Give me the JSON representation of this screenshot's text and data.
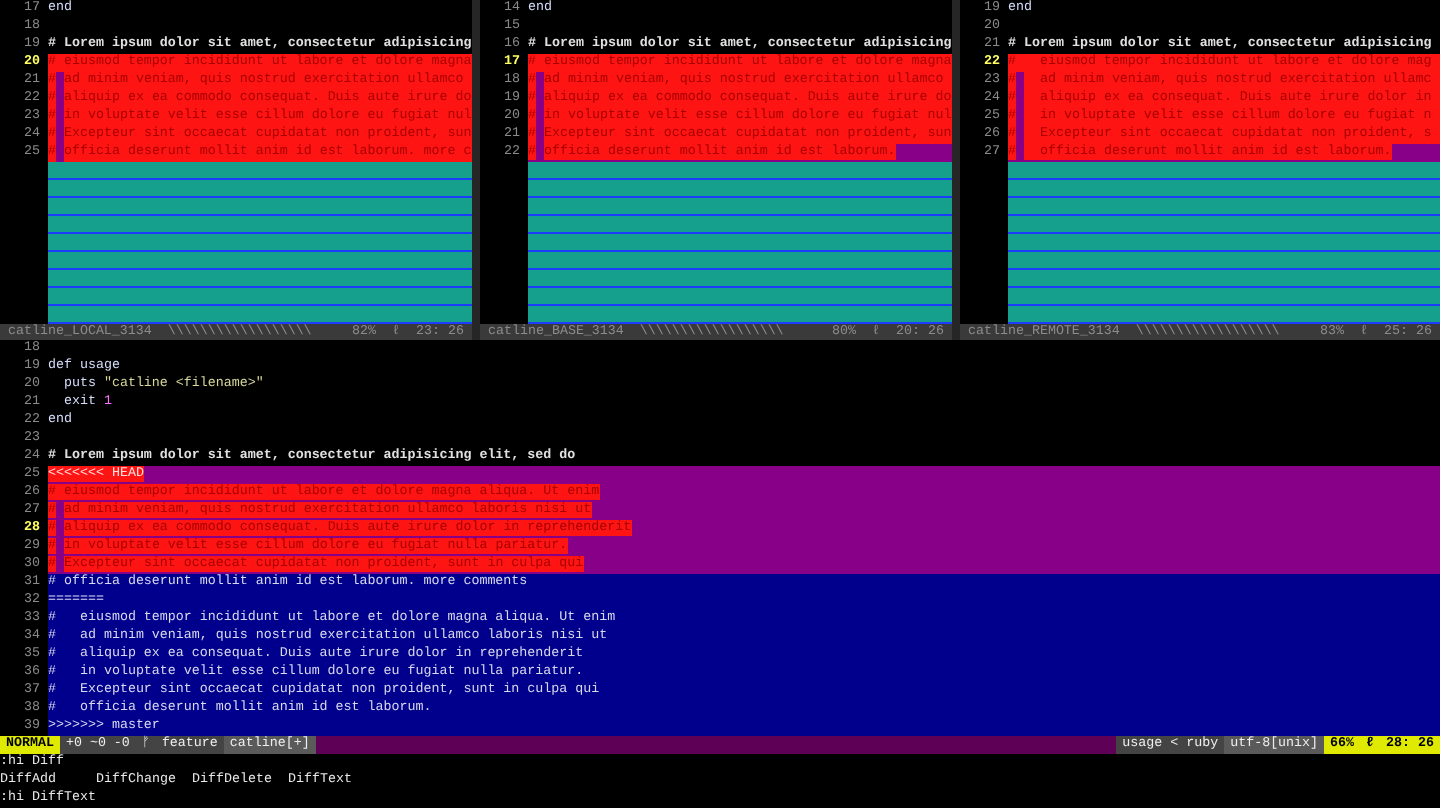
{
  "panes": [
    {
      "lines": [
        {
          "kind": "plain",
          "number": "17",
          "current": false,
          "segments": [
            {
              "text": "end",
              "kind": "keyword"
            }
          ]
        },
        {
          "kind": "plain",
          "number": "18",
          "current": false
        },
        {
          "kind": "plain",
          "number": "19",
          "current": false,
          "segments": [
            {
              "text": "# Lorem ipsum dolor sit amet, consectetur adipisicing",
              "kind": "comment"
            }
          ]
        },
        {
          "kind": "differing",
          "number": "20",
          "current": true,
          "segments": [
            {
              "text": "# eiusmod tempor incididunt ut labore et dolore magna",
              "kind": "differing"
            }
          ]
        },
        {
          "kind": "differing",
          "number": "21",
          "current": false,
          "segments": [
            {
              "text": "#",
              "kind": "differing"
            },
            {
              "kind": "changed_cell"
            },
            {
              "text": "ad minim veniam, quis nostrud exercitation ullamco",
              "kind": "differing"
            }
          ]
        },
        {
          "kind": "differing",
          "number": "22",
          "current": false,
          "segments": [
            {
              "text": "#",
              "kind": "differing"
            },
            {
              "kind": "changed_cell"
            },
            {
              "text": "aliquip ex ea commodo consequat. Duis aute irure do",
              "kind": "differing"
            }
          ]
        },
        {
          "kind": "differing",
          "number": "23",
          "current": false,
          "segments": [
            {
              "text": "#",
              "kind": "differing"
            },
            {
              "kind": "changed_cell"
            },
            {
              "text": "in voluptate velit esse cillum dolore eu fugiat nul",
              "kind": "differing"
            }
          ]
        },
        {
          "kind": "differing",
          "number": "24",
          "current": false,
          "segments": [
            {
              "text": "#",
              "kind": "differing"
            },
            {
              "kind": "changed_cell"
            },
            {
              "text": "Excepteur sint occaecat cupidatat non proident, sun",
              "kind": "differing"
            }
          ]
        },
        {
          "kind": "differing",
          "number": "25",
          "current": false,
          "segments": [
            {
              "text": "#",
              "kind": "differing"
            },
            {
              "kind": "changed_cell"
            },
            {
              "text": "officia deserunt mollit anim id est laborum. more c",
              "kind": "differing"
            }
          ]
        },
        {
          "kind": "filler"
        },
        {
          "kind": "filler"
        },
        {
          "kind": "filler"
        },
        {
          "kind": "filler"
        },
        {
          "kind": "filler"
        },
        {
          "kind": "filler"
        },
        {
          "kind": "filler"
        },
        {
          "kind": "filler"
        },
        {
          "kind": "filler"
        }
      ],
      "status": {
        "file": "catline_LOCAL_3134",
        "fill": "\\\\\\\\\\\\\\\\\\\\\\\\\\\\\\\\\\\\",
        "percent": "82%",
        "linenr_symbol": "ℓ",
        "position": "23: 26"
      }
    },
    {
      "lines": [
        {
          "kind": "plain",
          "number": "14",
          "current": false,
          "segments": [
            {
              "text": "end",
              "kind": "keyword"
            }
          ]
        },
        {
          "kind": "plain",
          "number": "15",
          "current": false
        },
        {
          "kind": "plain",
          "number": "16",
          "current": false,
          "segments": [
            {
              "text": "# Lorem ipsum dolor sit amet, consectetur adipisicing",
              "kind": "comment"
            }
          ]
        },
        {
          "kind": "differing",
          "number": "17",
          "current": true,
          "segments": [
            {
              "text": "# eiusmod tempor incididunt ut labore et dolore magna",
              "kind": "differing"
            }
          ]
        },
        {
          "kind": "differing",
          "number": "18",
          "current": false,
          "segments": [
            {
              "text": "#",
              "kind": "differing"
            },
            {
              "kind": "changed_cell"
            },
            {
              "text": "ad minim veniam, quis nostrud exercitation ullamco",
              "kind": "differing"
            }
          ]
        },
        {
          "kind": "differing",
          "number": "19",
          "current": false,
          "segments": [
            {
              "text": "#",
              "kind": "differing"
            },
            {
              "kind": "changed_cell"
            },
            {
              "text": "aliquip ex ea commodo consequat. Duis aute irure do",
              "kind": "differing"
            }
          ]
        },
        {
          "kind": "differing",
          "number": "20",
          "current": false,
          "segments": [
            {
              "text": "#",
              "kind": "differing"
            },
            {
              "kind": "changed_cell"
            },
            {
              "text": "in voluptate velit esse cillum dolore eu fugiat nul",
              "kind": "differing"
            }
          ]
        },
        {
          "kind": "differing",
          "number": "21",
          "current": false,
          "segments": [
            {
              "text": "#",
              "kind": "differing"
            },
            {
              "kind": "changed_cell"
            },
            {
              "text": "Excepteur sint occaecat cupidatat non proident, sun",
              "kind": "differing"
            }
          ]
        },
        {
          "kind": "changed",
          "number": "22",
          "current": false,
          "segments": [
            {
              "text": "#",
              "kind": "differing"
            },
            {
              "kind": "changed_cell"
            },
            {
              "text": "officia deserunt mollit anim id est laborum.",
              "kind": "differing"
            }
          ]
        },
        {
          "kind": "filler"
        },
        {
          "kind": "filler"
        },
        {
          "kind": "filler"
        },
        {
          "kind": "filler"
        },
        {
          "kind": "filler"
        },
        {
          "kind": "filler"
        },
        {
          "kind": "filler"
        },
        {
          "kind": "filler"
        },
        {
          "kind": "filler"
        }
      ],
      "status": {
        "file": "catline_BASE_3134",
        "fill": "\\\\\\\\\\\\\\\\\\\\\\\\\\\\\\\\\\\\",
        "percent": "80%",
        "linenr_symbol": "ℓ",
        "position": "20: 26"
      }
    },
    {
      "lines": [
        {
          "kind": "plain",
          "number": "19",
          "current": false,
          "segments": [
            {
              "text": "end",
              "kind": "keyword"
            }
          ]
        },
        {
          "kind": "plain",
          "number": "20",
          "current": false
        },
        {
          "kind": "plain",
          "number": "21",
          "current": false,
          "segments": [
            {
              "text": "# Lorem ipsum dolor sit amet, consectetur adipisicing",
              "kind": "comment"
            }
          ]
        },
        {
          "kind": "differing",
          "number": "22",
          "current": true,
          "segments": [
            {
              "text": "#   eiusmod tempor incididunt ut labore et dolore mag",
              "kind": "differing"
            }
          ]
        },
        {
          "kind": "differing",
          "number": "23",
          "current": false,
          "segments": [
            {
              "text": "#",
              "kind": "differing"
            },
            {
              "kind": "changed_cell"
            },
            {
              "text": "  ad minim veniam, quis nostrud exercitation ullamc",
              "kind": "differing"
            }
          ]
        },
        {
          "kind": "differing",
          "number": "24",
          "current": false,
          "segments": [
            {
              "text": "#",
              "kind": "differing"
            },
            {
              "kind": "changed_cell"
            },
            {
              "text": "  aliquip ex ea consequat. Duis aute irure dolor in",
              "kind": "differing"
            }
          ]
        },
        {
          "kind": "differing",
          "number": "25",
          "current": false,
          "segments": [
            {
              "text": "#",
              "kind": "differing"
            },
            {
              "kind": "changed_cell"
            },
            {
              "text": "  in voluptate velit esse cillum dolore eu fugiat n",
              "kind": "differing"
            }
          ]
        },
        {
          "kind": "differing",
          "number": "26",
          "current": false,
          "segments": [
            {
              "text": "#",
              "kind": "differing"
            },
            {
              "kind": "changed_cell"
            },
            {
              "text": "  Excepteur sint occaecat cupidatat non proident, s",
              "kind": "differing"
            }
          ]
        },
        {
          "kind": "changed",
          "number": "27",
          "current": false,
          "segments": [
            {
              "text": "#",
              "kind": "differing"
            },
            {
              "kind": "changed_cell"
            },
            {
              "text": "  officia deserunt mollit anim id est laborum.",
              "kind": "differing"
            }
          ]
        },
        {
          "kind": "filler"
        },
        {
          "kind": "filler"
        },
        {
          "kind": "filler"
        },
        {
          "kind": "filler"
        },
        {
          "kind": "filler"
        },
        {
          "kind": "filler"
        },
        {
          "kind": "filler"
        },
        {
          "kind": "filler"
        },
        {
          "kind": "filler"
        }
      ],
      "status": {
        "file": "catline_REMOTE_3134",
        "fill": "\\\\\\\\\\\\\\\\\\\\\\\\\\\\\\\\\\\\",
        "percent": "83%",
        "linenr_symbol": "ℓ",
        "position": "25: 26"
      }
    }
  ],
  "main": {
    "lines": [
      {
        "kind": "plain",
        "number": "18",
        "current": false
      },
      {
        "kind": "plain",
        "number": "19",
        "current": false,
        "segments": [
          {
            "text": "def usage",
            "kind": "keyword"
          }
        ]
      },
      {
        "kind": "plain",
        "number": "20",
        "current": false,
        "segments": [
          {
            "text": "  puts",
            "kind": "keyword"
          },
          {
            "text": " \"catline <filename>\"",
            "kind": "string"
          }
        ]
      },
      {
        "kind": "plain",
        "number": "21",
        "current": false,
        "segments": [
          {
            "text": "  exit",
            "kind": "keyword"
          },
          {
            "text": " 1",
            "kind": "number"
          }
        ]
      },
      {
        "kind": "plain",
        "number": "22",
        "current": false,
        "segments": [
          {
            "text": "end",
            "kind": "keyword"
          }
        ]
      },
      {
        "kind": "plain",
        "number": "23",
        "current": false
      },
      {
        "kind": "plain",
        "number": "24",
        "current": false,
        "segments": [
          {
            "text": "# Lorem ipsum dolor sit amet, consectetur adipisicing elit, sed do",
            "kind": "comment"
          }
        ]
      },
      {
        "kind": "changed",
        "number": "25",
        "current": false,
        "segments": [
          {
            "text": "<<<<<<< HEAD",
            "kind": "conflict_marker"
          }
        ]
      },
      {
        "kind": "changed",
        "number": "26",
        "current": false,
        "segments": [
          {
            "text": "# eiusmod tempor incididunt ut labore et dolore magna aliqua. Ut enim",
            "kind": "differing"
          }
        ]
      },
      {
        "kind": "changed",
        "number": "27",
        "current": false,
        "segments": [
          {
            "text": "#",
            "kind": "differing"
          },
          {
            "kind": "changed_cell"
          },
          {
            "text": "ad minim veniam, quis nostrud exercitation ullamco laboris nisi ut",
            "kind": "differing"
          }
        ]
      },
      {
        "kind": "changed",
        "number": "28",
        "current": true,
        "segments": [
          {
            "text": "#",
            "kind": "differing"
          },
          {
            "kind": "changed_cell"
          },
          {
            "text": "aliquip ex ea commodo consequat. Duis aute irure dolor in reprehenderit",
            "kind": "differing"
          }
        ]
      },
      {
        "kind": "changed",
        "number": "29",
        "current": false,
        "segments": [
          {
            "text": "#",
            "kind": "differing"
          },
          {
            "kind": "changed_cell"
          },
          {
            "text": "in voluptate velit esse cillum dolore eu fugiat nulla pariatur.",
            "kind": "differing"
          }
        ]
      },
      {
        "kind": "changed",
        "number": "30",
        "current": false,
        "segments": [
          {
            "text": "#",
            "kind": "differing"
          },
          {
            "kind": "changed_cell"
          },
          {
            "text": "Excepteur sint occaecat cupidatat non proident, sunt in culpa qui",
            "kind": "differing"
          }
        ]
      },
      {
        "kind": "added",
        "number": "31",
        "current": false,
        "segments": [
          {
            "text": "# officia deserunt mollit anim id est laborum. more comments",
            "kind": "plain"
          }
        ]
      },
      {
        "kind": "added",
        "number": "32",
        "current": false,
        "segments": [
          {
            "text": "=======",
            "kind": "plain"
          }
        ]
      },
      {
        "kind": "added",
        "number": "33",
        "current": false,
        "segments": [
          {
            "text": "#   eiusmod tempor incididunt ut labore et dolore magna aliqua. Ut enim",
            "kind": "plain"
          }
        ]
      },
      {
        "kind": "added",
        "number": "34",
        "current": false,
        "segments": [
          {
            "text": "#   ad minim veniam, quis nostrud exercitation ullamco laboris nisi ut",
            "kind": "plain"
          }
        ]
      },
      {
        "kind": "added",
        "number": "35",
        "current": false,
        "segments": [
          {
            "text": "#   aliquip ex ea consequat. Duis aute irure dolor in reprehenderit",
            "kind": "plain"
          }
        ]
      },
      {
        "kind": "added",
        "number": "36",
        "current": false,
        "segments": [
          {
            "text": "#   in voluptate velit esse cillum dolore eu fugiat nulla pariatur.",
            "kind": "plain"
          }
        ]
      },
      {
        "kind": "added",
        "number": "37",
        "current": false,
        "segments": [
          {
            "text": "#   Excepteur sint occaecat cupidatat non proident, sunt in culpa qui",
            "kind": "plain"
          }
        ]
      },
      {
        "kind": "added",
        "number": "38",
        "current": false,
        "segments": [
          {
            "text": "#   officia deserunt mollit anim id est laborum.",
            "kind": "plain"
          }
        ]
      },
      {
        "kind": "added",
        "number": "39",
        "current": false,
        "segments": [
          {
            "text": ">>>>>>> master",
            "kind": "plain"
          }
        ]
      }
    ],
    "status": {
      "mode": "NORMAL",
      "hunks": "+0 ~0 -0",
      "branch_symbol": "ᚠ",
      "branch": "feature",
      "file": "catline[+]",
      "tag": "usage",
      "separator": "<",
      "filetype": "ruby",
      "encoding": "utf-8[unix]",
      "percent": "66%",
      "linenr_symbol": "ℓ",
      "position": "28: 26"
    }
  },
  "cmdline": [
    {
      "kind": "command",
      "text": ":hi Diff"
    },
    {
      "kind": "groups",
      "items": [
        "DiffAdd",
        "DiffChange",
        "DiffDelete",
        "DiffText"
      ]
    },
    {
      "kind": "command",
      "text": ":hi DiffText"
    }
  ]
}
